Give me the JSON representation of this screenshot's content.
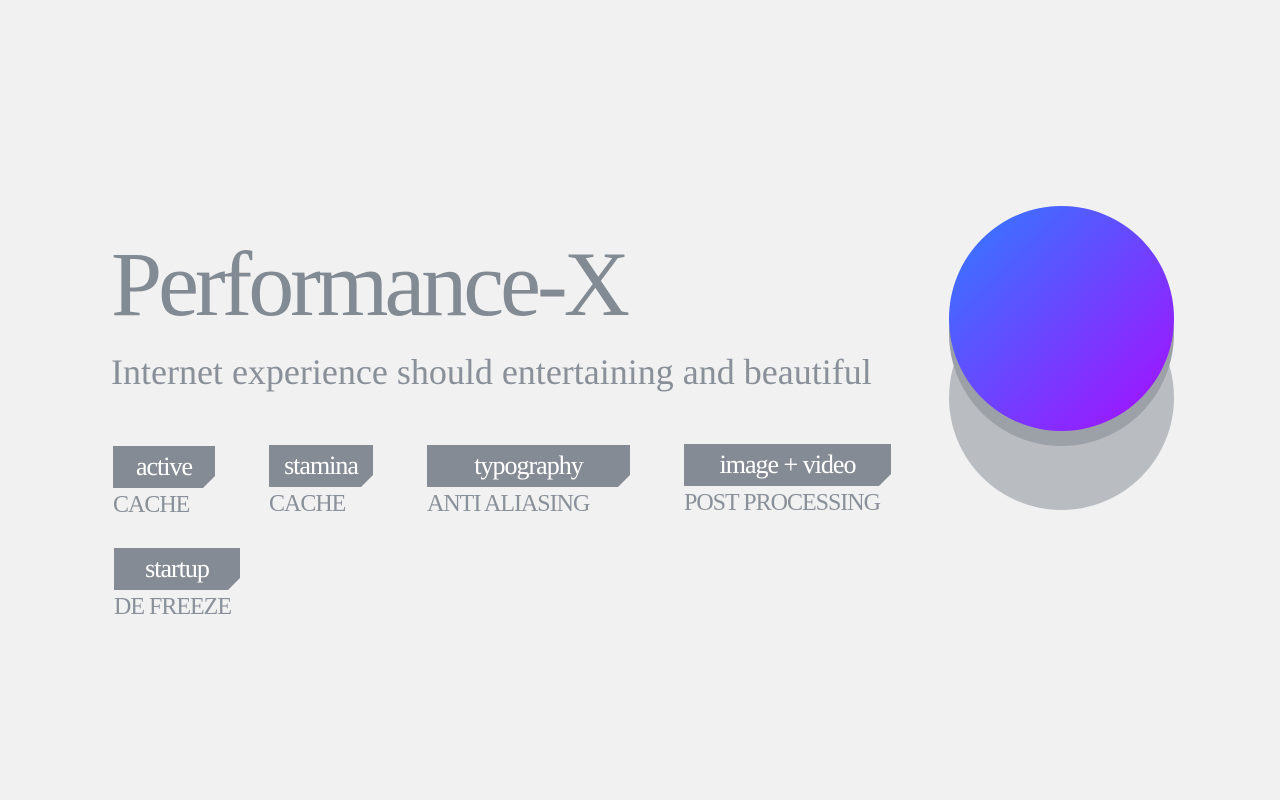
{
  "hero": {
    "title": "Performance-X",
    "subtitle": "Internet experience should entertaining and beautiful"
  },
  "features": [
    {
      "tag": "active",
      "caption": "CACHE"
    },
    {
      "tag": "stamina",
      "caption": "CACHE"
    },
    {
      "tag": "typography",
      "caption": "ANTI ALIASING"
    },
    {
      "tag": "image + video",
      "caption": "POST PROCESSING"
    },
    {
      "tag": "startup",
      "caption": "DE FREEZE"
    }
  ],
  "orb": {
    "gradient_start": "#2f7dff",
    "gradient_end": "#a80cff",
    "shadow_color": "#b9bcc1"
  },
  "colors": {
    "background": "#f1f1f1",
    "text": "#828a93",
    "tag_background": "#858b94"
  }
}
